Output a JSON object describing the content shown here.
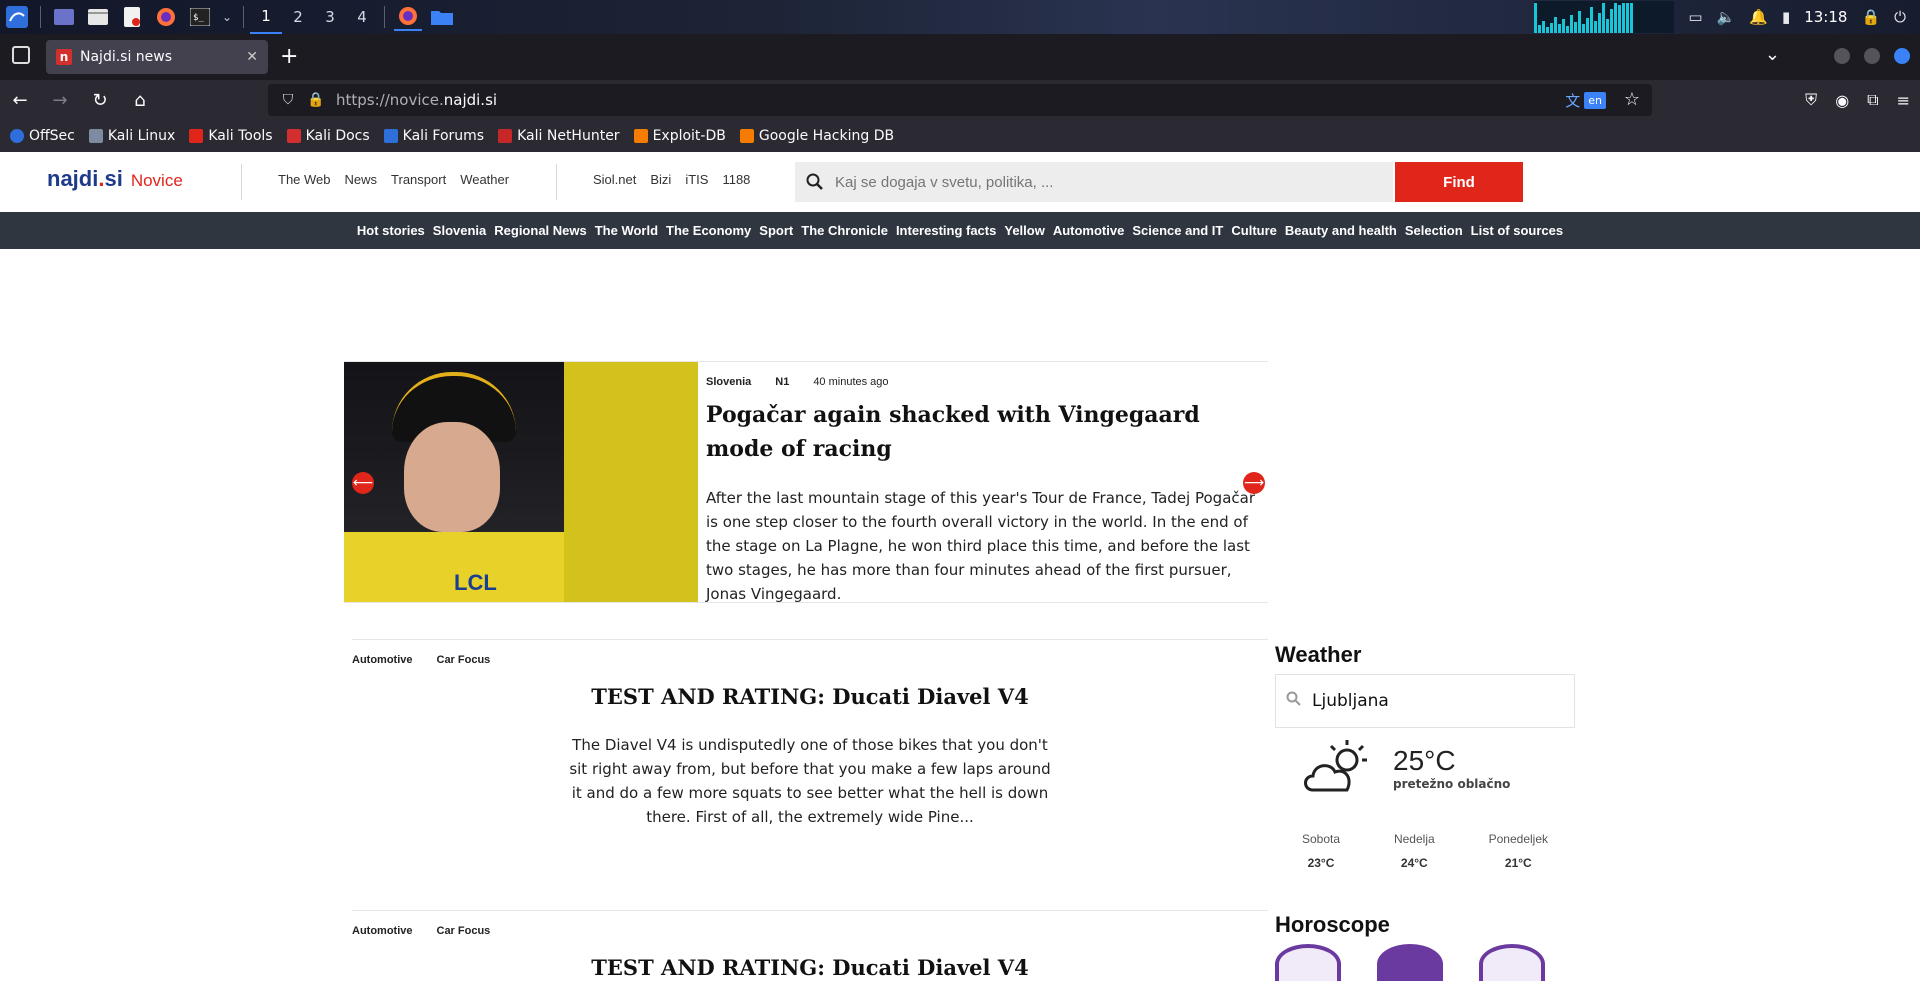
{
  "taskbar": {
    "workspaces": [
      "1",
      "2",
      "3",
      "4"
    ],
    "clock": "13:18"
  },
  "browser": {
    "tab_title": "Najdi.si news",
    "tab_favicon_letter": "n",
    "url_prefix": "https://novice.",
    "url_domain": "najdi.si",
    "translate_badge": "en",
    "bookmarks": [
      "OffSec",
      "Kali Linux",
      "Kali Tools",
      "Kali Docs",
      "Kali Forums",
      "Kali NetHunter",
      "Exploit-DB",
      "Google Hacking DB"
    ]
  },
  "site": {
    "logo": "najdi.si",
    "logo_main": "najdi",
    "logo_dot": ".",
    "logo_tld": "si",
    "logo_sub": "Novice",
    "header_links_1": [
      "The Web",
      "News",
      "Transport",
      "Weather"
    ],
    "header_links_2": [
      "Siol.net",
      "Bizi",
      "iTIS",
      "1188"
    ],
    "search_placeholder": "Kaj se dogaja v svetu, politika, ...",
    "find_label": "Find",
    "categories": [
      "Hot stories",
      "Slovenia",
      "Regional News",
      "The World",
      "The Economy",
      "Sport",
      "The Chronicle",
      "Interesting facts",
      "Yellow",
      "Automotive",
      "Science and IT",
      "Culture",
      "Beauty and health",
      "Selection",
      "List of sources"
    ]
  },
  "featured": {
    "category": "Slovenia",
    "source": "N1",
    "time": "40 minutes ago",
    "title": "Pogačar again shacked with Vingegaard mode of racing",
    "text": "After the last mountain stage of this year's Tour de France, Tadej Pogačar is one step closer to the fourth overall victory in the world. In the end of the stage on La Plagne, he won third place this time, and before the last two stages, he has more than four minutes ahead of the first pursuer, Jonas Vingegaard.",
    "image_text": "LCL"
  },
  "articles": [
    {
      "category": "Automotive",
      "source": "Car Focus",
      "title": "TEST AND RATING: Ducati Diavel V4",
      "text": "The Diavel V4 is undisputedly one of those bikes that you don't sit right away from, but before that you make a few laps around it and do a few more squats to see better what the hell is down there. First of all, the extremely wide Pine..."
    },
    {
      "category": "Automotive",
      "source": "Car Focus",
      "title": "TEST AND RATING: Ducati Diavel V4",
      "text": ""
    }
  ],
  "weather": {
    "heading": "Weather",
    "city": "Ljubljana",
    "temp": "25°C",
    "desc": "pretežno oblačno",
    "forecast": [
      {
        "day": "Sobota",
        "temp": "23°C"
      },
      {
        "day": "Nedelja",
        "temp": "24°C"
      },
      {
        "day": "Ponedeljek",
        "temp": "21°C"
      }
    ]
  },
  "horoscope": {
    "heading": "Horoscope"
  },
  "colors": {
    "brand_blue": "#1e3a8a",
    "brand_red": "#e0251b",
    "catbar": "#2f3640"
  }
}
